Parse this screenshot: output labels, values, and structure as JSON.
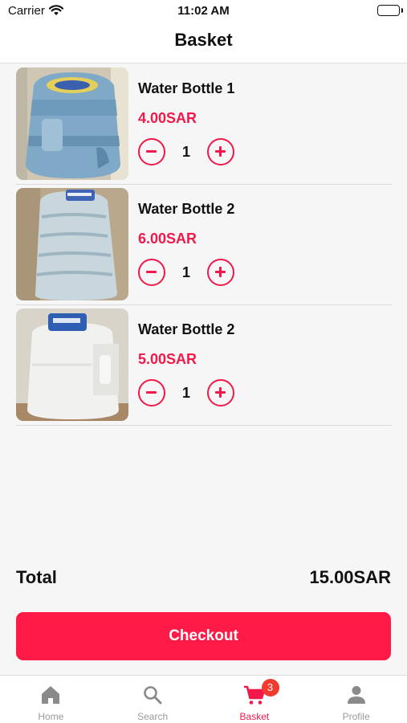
{
  "status_bar": {
    "carrier": "Carrier",
    "time": "11:02 AM"
  },
  "header": {
    "title": "Basket"
  },
  "basket": {
    "items": [
      {
        "name": "Water Bottle 1",
        "price": "4.00SAR",
        "quantity": "1",
        "image": "blue water jug"
      },
      {
        "name": "Water Bottle 2",
        "price": "6.00SAR",
        "quantity": "1",
        "image": "clear water bottle"
      },
      {
        "name": "Water Bottle 2",
        "price": "5.00SAR",
        "quantity": "1",
        "image": "white water container"
      }
    ],
    "total_label": "Total",
    "total_value": "15.00SAR",
    "checkout_label": "Checkout"
  },
  "tab_bar": {
    "tabs": [
      {
        "label": "Home",
        "icon": "home-icon"
      },
      {
        "label": "Search",
        "icon": "search-icon"
      },
      {
        "label": "Basket",
        "icon": "cart-icon",
        "badge": "3",
        "active": true
      },
      {
        "label": "Profile",
        "icon": "person-icon"
      }
    ]
  },
  "colors": {
    "accent": "#f0194a",
    "checkout": "#ff1a47",
    "badge": "#f23b2f",
    "inactive_tab": "#9a9a9a"
  }
}
